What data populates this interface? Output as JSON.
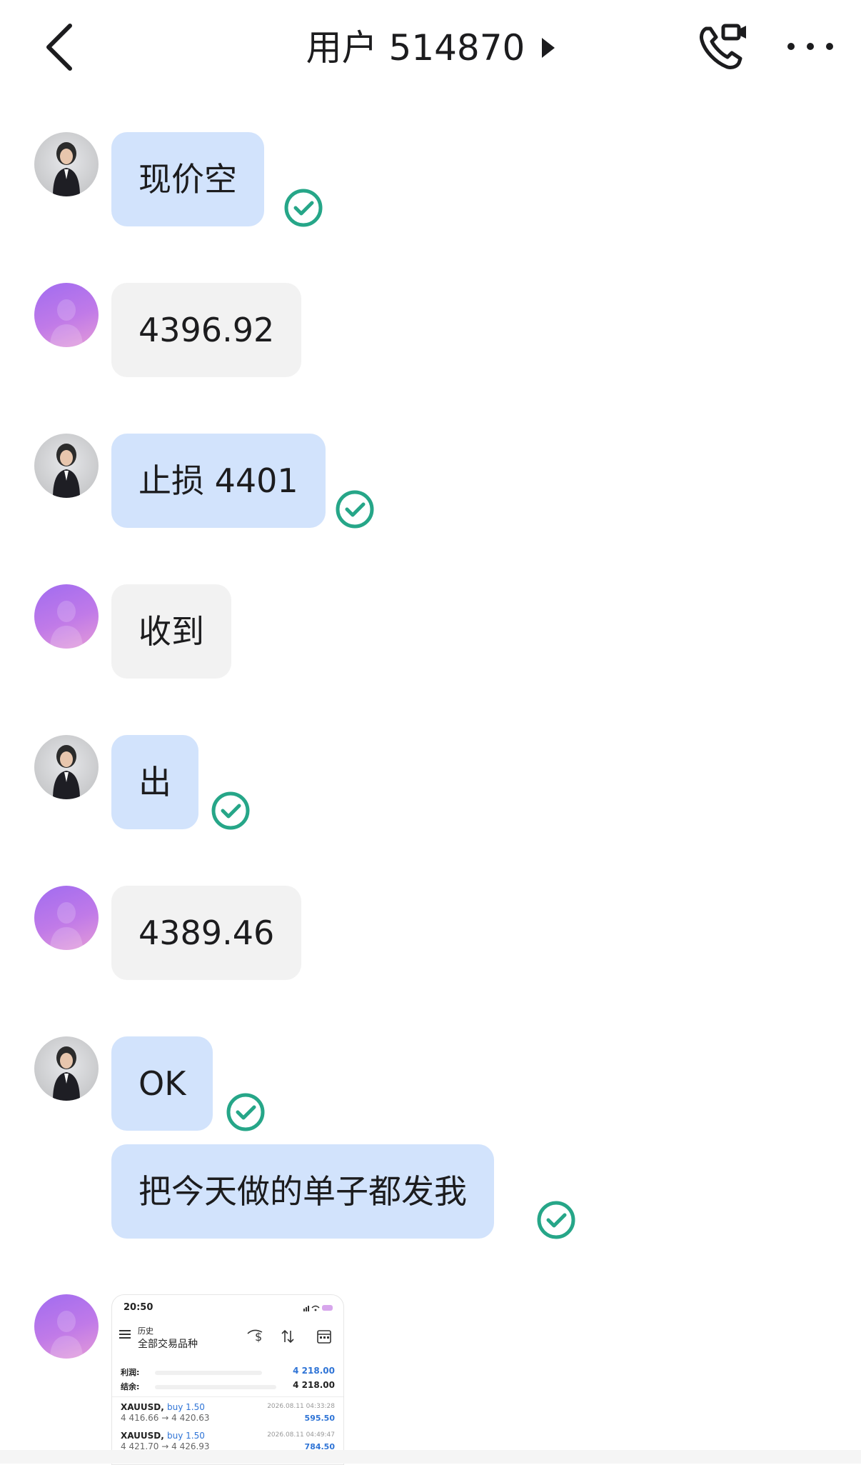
{
  "header": {
    "title": "用户 514870",
    "icons": {
      "back": "chevron-left-icon",
      "call": "phone-video-icon",
      "more": "more-dots-icon"
    }
  },
  "messages": [
    {
      "sender": "agent",
      "text": "现价空",
      "read": true
    },
    {
      "sender": "user",
      "text": "4396.92"
    },
    {
      "sender": "agent",
      "text": "止损 4401",
      "read": true
    },
    {
      "sender": "user",
      "text": "收到"
    },
    {
      "sender": "agent",
      "text": "出",
      "read": true
    },
    {
      "sender": "user",
      "text": "4389.46"
    },
    {
      "sender": "agent",
      "text": "OK",
      "read": true
    },
    {
      "sender": "agent",
      "text": "把今天做的单子都发我",
      "read": true
    }
  ],
  "screenshot_preview": {
    "time": "20:50",
    "history_label": "历史",
    "filter_label": "全部交易品种",
    "profit_label": "利润:",
    "profit_value": "4 218.00",
    "balance_label": "结余:",
    "balance_value": "4 218.00",
    "trades": [
      {
        "symbol": "XAUUSD,",
        "side": "buy 1.50",
        "prices": "4 416.66 → 4 420.63",
        "datetime": "2026.08.11 04:33:28",
        "pl": "595.50"
      },
      {
        "symbol": "XAUUSD,",
        "side": "buy 1.50",
        "prices": "4 421.70 → 4 426.93",
        "datetime": "2026.08.11 04:49:47",
        "pl": "784.50"
      }
    ]
  },
  "colors": {
    "my_bubble": "#d2e3fc",
    "their_bubble": "#f2f2f2",
    "read_check": "#26a688",
    "user_avatar": "#b274ec"
  }
}
